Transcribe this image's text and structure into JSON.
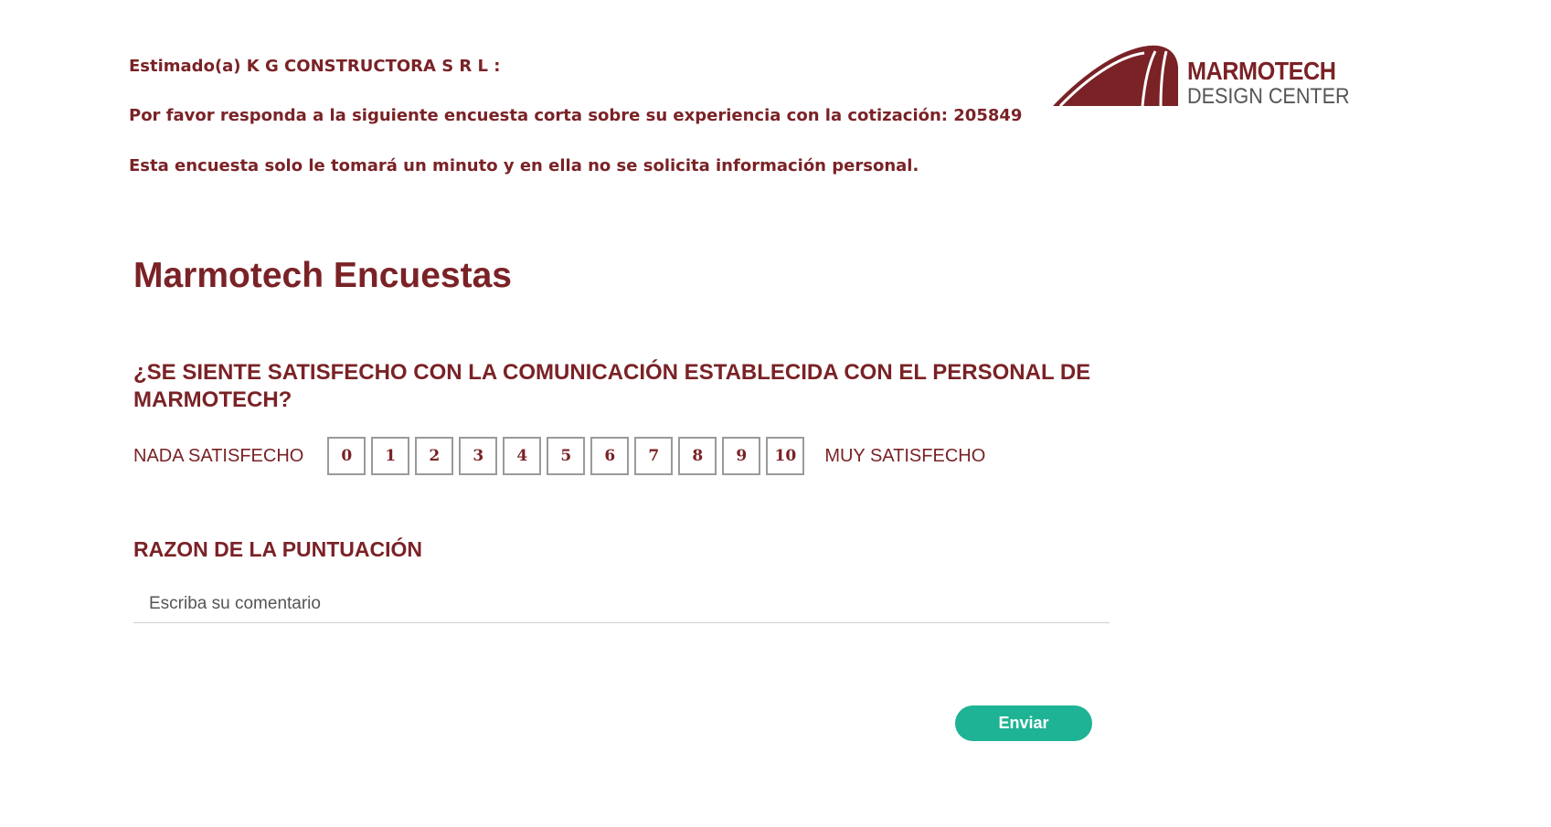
{
  "intro": {
    "greeting": "Estimado(a) K G CONSTRUCTORA S R L :",
    "request": "Por favor responda a la siguiente encuesta corta sobre su experiencia con la cotización: 205849",
    "note": "Esta encuesta solo le tomará un minuto y en ella no se solicita información personal."
  },
  "logo": {
    "line1": "MARMOTECH",
    "line2": "DESIGN CENTER",
    "brand_color": "#7a2226",
    "secondary_color": "#555555"
  },
  "survey": {
    "title": "Marmotech Encuestas",
    "question": "¿SE SIENTE SATISFECHO CON LA COMUNICACIÓN ESTABLECIDA CON EL PERSONAL DE MARMOTECH?",
    "scale": {
      "low_label": "NADA SATISFECHO",
      "high_label": "MUY SATISFECHO",
      "options": [
        "0",
        "1",
        "2",
        "3",
        "4",
        "5",
        "6",
        "7",
        "8",
        "9",
        "10"
      ]
    },
    "reason_label": "RAZON DE LA PUNTUACIÓN",
    "comment": {
      "placeholder": "Escriba su comentario",
      "value": ""
    },
    "submit_label": "Enviar"
  },
  "colors": {
    "accent": "#7a2226",
    "button": "#1eb394",
    "option_border": "#9a9a9a"
  }
}
